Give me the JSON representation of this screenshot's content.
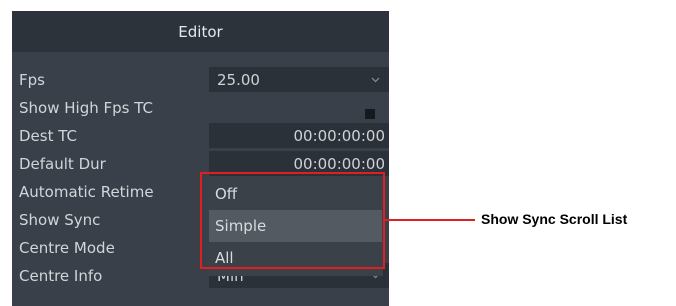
{
  "panel": {
    "title": "Editor",
    "rows": {
      "fps": {
        "label": "Fps",
        "value": "25.00"
      },
      "show_high_fps_tc": {
        "label": "Show High Fps TC"
      },
      "dest_tc": {
        "label": "Dest TC",
        "value": "00:00:00:00"
      },
      "default_dur": {
        "label": "Default Dur",
        "value": "00:00:00:00"
      },
      "automatic_retime": {
        "label": "Automatic Retime"
      },
      "show_sync": {
        "label": "Show Sync"
      },
      "centre_mode": {
        "label": "Centre Mode"
      },
      "centre_info": {
        "label": "Centre Info",
        "value": "Min"
      }
    },
    "sync_dropdown": {
      "options": [
        "Off",
        "Simple",
        "All"
      ],
      "selected": "Simple"
    }
  },
  "callout": {
    "text": "Show Sync Scroll List",
    "color": "#e02020"
  },
  "icons": {
    "dropdown_arrow": "chevron-down-icon",
    "checkbox": "checkbox-unchecked"
  }
}
